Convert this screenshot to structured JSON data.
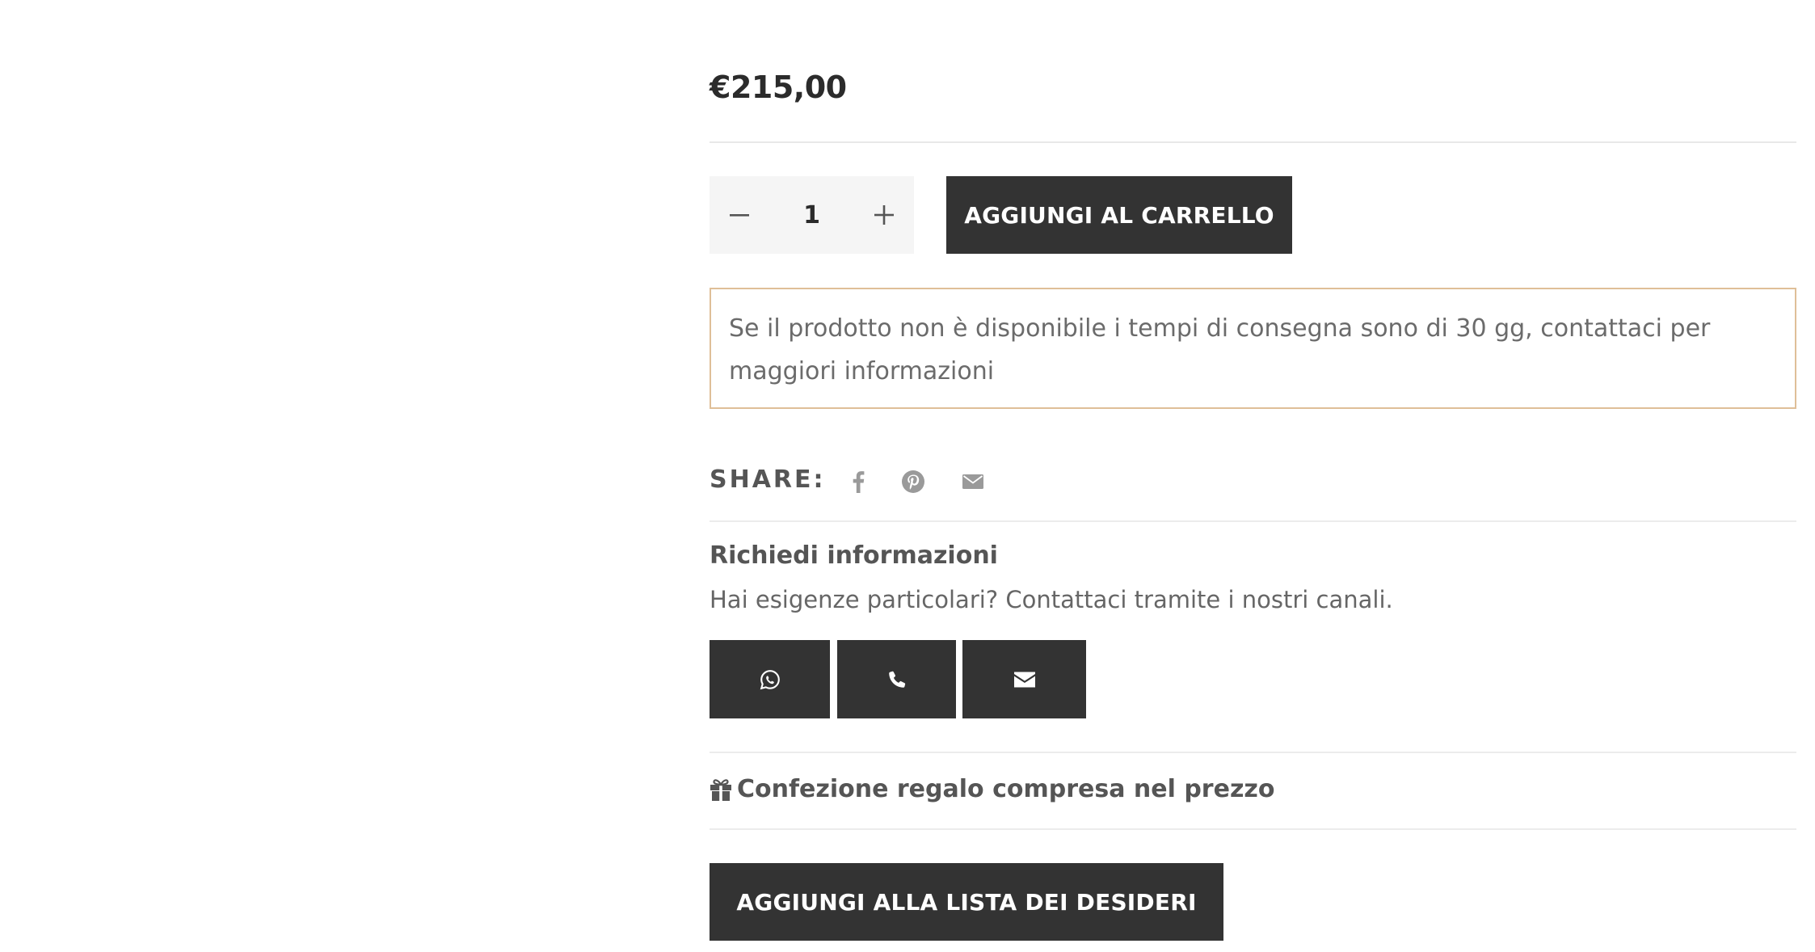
{
  "product": {
    "price": "€215,00"
  },
  "cart": {
    "quantity": "1",
    "add_to_cart_label": "AGGIUNGI AL CARRELLO"
  },
  "notice": {
    "text": "Se il prodotto non è disponibile i tempi di consegna sono di 30 gg, contattaci per maggiori informazioni",
    "border_color": "#dfbf98"
  },
  "share": {
    "label": "SHARE:",
    "icons": [
      "facebook-icon",
      "pinterest-icon",
      "mail-icon"
    ]
  },
  "info": {
    "title": "Richiedi informazioni",
    "subtitle": "Hai esigenze particolari? Contattaci tramite i nostri canali.",
    "contact_icons": [
      "whatsapp-icon",
      "phone-icon",
      "envelope-icon"
    ]
  },
  "gift": {
    "text": "Confezione regalo compresa nel prezzo",
    "icon": "gift-icon"
  },
  "wishlist": {
    "label": "AGGIUNGI ALLA LISTA DEI DESIDERI"
  },
  "colors": {
    "button_dark": "#333333",
    "qty_background": "#f5f5f5",
    "text": "#555555"
  }
}
